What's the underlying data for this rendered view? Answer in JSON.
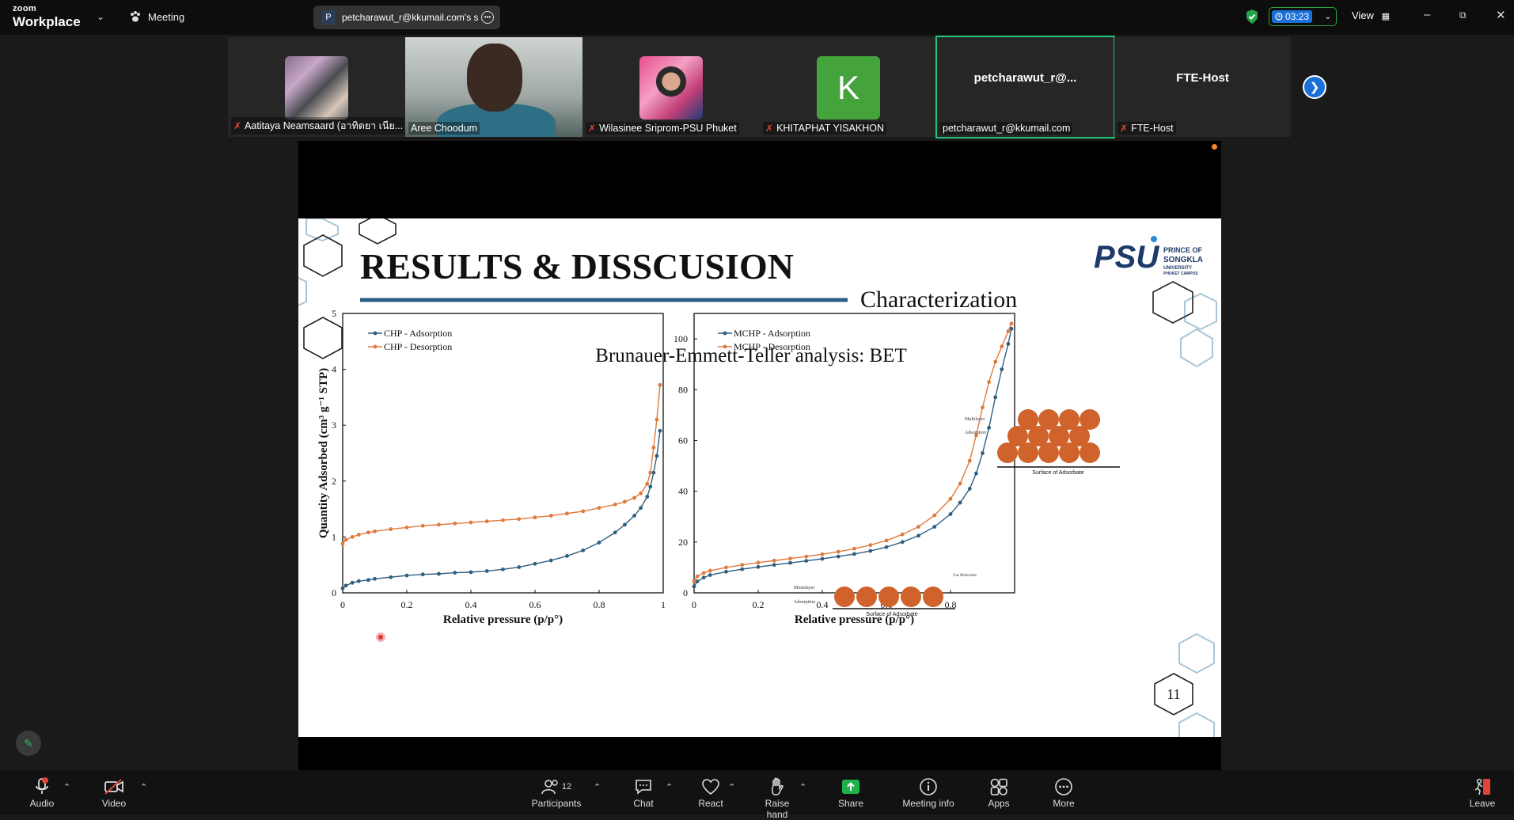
{
  "topbar": {
    "logo_small": "zoom",
    "logo_big": "Workplace",
    "meeting_label": "Meeting",
    "share_avatar": "P",
    "share_label": "petcharawut_r@kkumail.com's s",
    "timer": "03:23",
    "view_label": "View"
  },
  "participants": [
    {
      "name": "Aatitaya Neamsaard (อาทิตยา เนีย...",
      "muted": true
    },
    {
      "name": "Aree Choodum",
      "muted": false
    },
    {
      "name": "Wilasinee Sriprom-PSU Phuket",
      "muted": true
    },
    {
      "name": "KHITAPHAT YISAKHON",
      "muted": true,
      "initial": "K"
    },
    {
      "name": "petcharawut_r@kkumail.com",
      "display": "petcharawut_r@...",
      "muted": false
    },
    {
      "name": "FTE-Host",
      "display": "FTE-Host",
      "muted": true
    }
  ],
  "slide": {
    "title": "RESULTS & DISSCUSION",
    "subtitle": "Characterization",
    "heading": "Brunauer-Emmett-Teller analysis: BET",
    "logo_text": "PSU",
    "logo_line1": "PRINCE OF",
    "logo_line2": "SONGKLA",
    "logo_line3": "UNIVERSITY",
    "logo_line4": "PHUKET CAMPUS",
    "page_number": "11",
    "inset_multilayer_label": "Multilayer",
    "inset_multilayer_label2": "Adsorption",
    "inset_multilayer_surface": "Surface of Adsorbate",
    "inset_monolayer_label": "Monolayer",
    "inset_monolayer_label2": "Adsorption",
    "inset_monolayer_surface": "Surface of Adsorbate",
    "inset_gas": "Gas Molecules"
  },
  "chart_data": [
    {
      "type": "line",
      "title": "",
      "xlabel": "Relative pressure (p/p°)",
      "ylabel": "Quantity Adsorbed (cm³ g⁻¹ STP)",
      "xlim": [
        0,
        1
      ],
      "ylim": [
        0,
        5
      ],
      "xticks": [
        "0",
        "0.2",
        "0.4",
        "0.6",
        "0.8",
        "1"
      ],
      "yticks": [
        "0",
        "1",
        "2",
        "3",
        "4",
        "5"
      ],
      "legend_position": "top-left",
      "series": [
        {
          "name": "CHP - Adsorption",
          "color": "#2f5f80",
          "x": [
            0.0,
            0.01,
            0.03,
            0.05,
            0.08,
            0.1,
            0.15,
            0.2,
            0.25,
            0.3,
            0.35,
            0.4,
            0.45,
            0.5,
            0.55,
            0.6,
            0.65,
            0.7,
            0.75,
            0.8,
            0.85,
            0.88,
            0.91,
            0.93,
            0.95,
            0.96,
            0.97,
            0.98,
            0.99
          ],
          "y": [
            0.08,
            0.13,
            0.18,
            0.21,
            0.23,
            0.25,
            0.28,
            0.31,
            0.33,
            0.34,
            0.36,
            0.37,
            0.39,
            0.42,
            0.46,
            0.52,
            0.58,
            0.66,
            0.76,
            0.9,
            1.08,
            1.22,
            1.38,
            1.52,
            1.72,
            1.9,
            2.15,
            2.45,
            2.9
          ]
        },
        {
          "name": "CHP - Desorption",
          "color": "#e07a3c",
          "x": [
            0.0,
            0.01,
            0.03,
            0.05,
            0.08,
            0.1,
            0.15,
            0.2,
            0.25,
            0.3,
            0.35,
            0.4,
            0.45,
            0.5,
            0.55,
            0.6,
            0.65,
            0.7,
            0.75,
            0.8,
            0.85,
            0.88,
            0.91,
            0.93,
            0.95,
            0.96,
            0.97,
            0.98,
            0.99
          ],
          "y": [
            0.88,
            0.95,
            1.0,
            1.04,
            1.08,
            1.1,
            1.14,
            1.17,
            1.2,
            1.22,
            1.24,
            1.26,
            1.28,
            1.3,
            1.32,
            1.35,
            1.38,
            1.42,
            1.46,
            1.52,
            1.58,
            1.63,
            1.7,
            1.78,
            1.95,
            2.15,
            2.6,
            3.1,
            3.72
          ]
        }
      ]
    },
    {
      "type": "line",
      "title": "",
      "xlabel": "Relative pressure (p/p°)",
      "ylabel": "",
      "xlim": [
        0,
        1
      ],
      "ylim": [
        0,
        110
      ],
      "xticks": [
        "0",
        "0.2",
        "0.4",
        "0.6",
        "0.8",
        ""
      ],
      "yticks": [
        "0",
        "20",
        "40",
        "60",
        "80",
        "100"
      ],
      "legend_position": "top-left",
      "series": [
        {
          "name": "MCHP - Adsorption",
          "color": "#2f5f80",
          "x": [
            0.0,
            0.01,
            0.03,
            0.05,
            0.1,
            0.15,
            0.2,
            0.25,
            0.3,
            0.35,
            0.4,
            0.45,
            0.5,
            0.55,
            0.6,
            0.65,
            0.7,
            0.75,
            0.8,
            0.83,
            0.86,
            0.88,
            0.9,
            0.92,
            0.94,
            0.96,
            0.98,
            0.99
          ],
          "y": [
            2.5,
            4.5,
            6.0,
            7.0,
            8.3,
            9.3,
            10.2,
            11.0,
            11.8,
            12.6,
            13.4,
            14.3,
            15.3,
            16.5,
            18.0,
            20.0,
            22.5,
            26.0,
            31.0,
            35.5,
            41.0,
            47.0,
            55.0,
            65.0,
            77.0,
            88.0,
            98.0,
            104.0
          ]
        },
        {
          "name": "MCHP - Desorption",
          "color": "#e07a3c",
          "x": [
            0.0,
            0.01,
            0.03,
            0.05,
            0.1,
            0.15,
            0.2,
            0.25,
            0.3,
            0.35,
            0.4,
            0.45,
            0.5,
            0.55,
            0.6,
            0.65,
            0.7,
            0.75,
            0.8,
            0.83,
            0.86,
            0.88,
            0.9,
            0.92,
            0.94,
            0.96,
            0.98,
            0.99
          ],
          "y": [
            4.5,
            6.5,
            7.8,
            8.7,
            10.0,
            11.0,
            11.9,
            12.7,
            13.5,
            14.3,
            15.2,
            16.2,
            17.4,
            18.8,
            20.6,
            23.0,
            26.0,
            30.5,
            37.0,
            43.0,
            52.0,
            62.0,
            73.0,
            83.0,
            91.0,
            97.0,
            103.0,
            106.0
          ]
        }
      ]
    }
  ],
  "toolbar": {
    "audio": "Audio",
    "video": "Video",
    "participants": "Participants",
    "participants_count": "12",
    "chat": "Chat",
    "react": "React",
    "raise_hand": "Raise hand",
    "share": "Share",
    "meeting_info": "Meeting info",
    "apps": "Apps",
    "more": "More",
    "leave": "Leave"
  },
  "colors": {
    "accent_green": "#23c27a",
    "share_green": "#1fb24a",
    "blue": "#1b6fd8",
    "muted_red": "#e0453a"
  }
}
